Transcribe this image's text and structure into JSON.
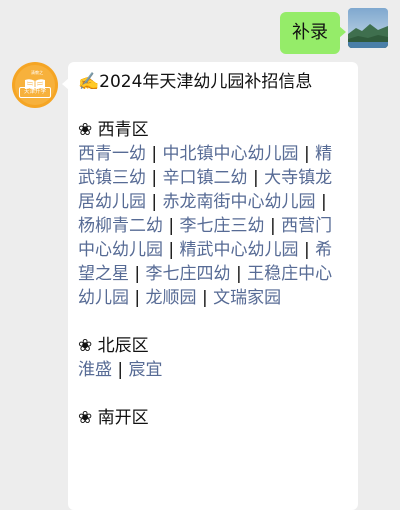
{
  "outgoing": {
    "text": "补录"
  },
  "incoming": {
    "brand": {
      "small_text": "清教之",
      "label": "天津升学"
    },
    "title": "✍️2024年天津幼儿园补招信息",
    "sections": [
      {
        "title": "❀ 西青区",
        "items": [
          "西青一幼",
          "中北镇中心幼儿园",
          "精武镇三幼",
          "辛口镇二幼",
          "大寺镇龙居幼儿园",
          "赤龙南街中心幼儿园",
          "杨柳青二幼",
          "李七庄三幼",
          "西营门中心幼儿园",
          "精武中心幼儿园",
          "希望之星",
          "李七庄四幼",
          "王稳庄中心幼儿园",
          "龙顺园",
          "文瑞家园"
        ]
      },
      {
        "title": "❀ 北辰区",
        "items": [
          "淮盛",
          "宸宜"
        ]
      },
      {
        "title": "❀ 南开区",
        "items": []
      }
    ],
    "separator": " | "
  },
  "colors": {
    "chat_background": "#ededed",
    "outgoing_bubble": "#95ec69",
    "incoming_bubble": "#ffffff",
    "link": "#576b95",
    "brand": "#f5a524"
  },
  "icons": {
    "user_avatar": "landscape-photo-avatar",
    "brand_avatar": "book-logo-avatar"
  }
}
